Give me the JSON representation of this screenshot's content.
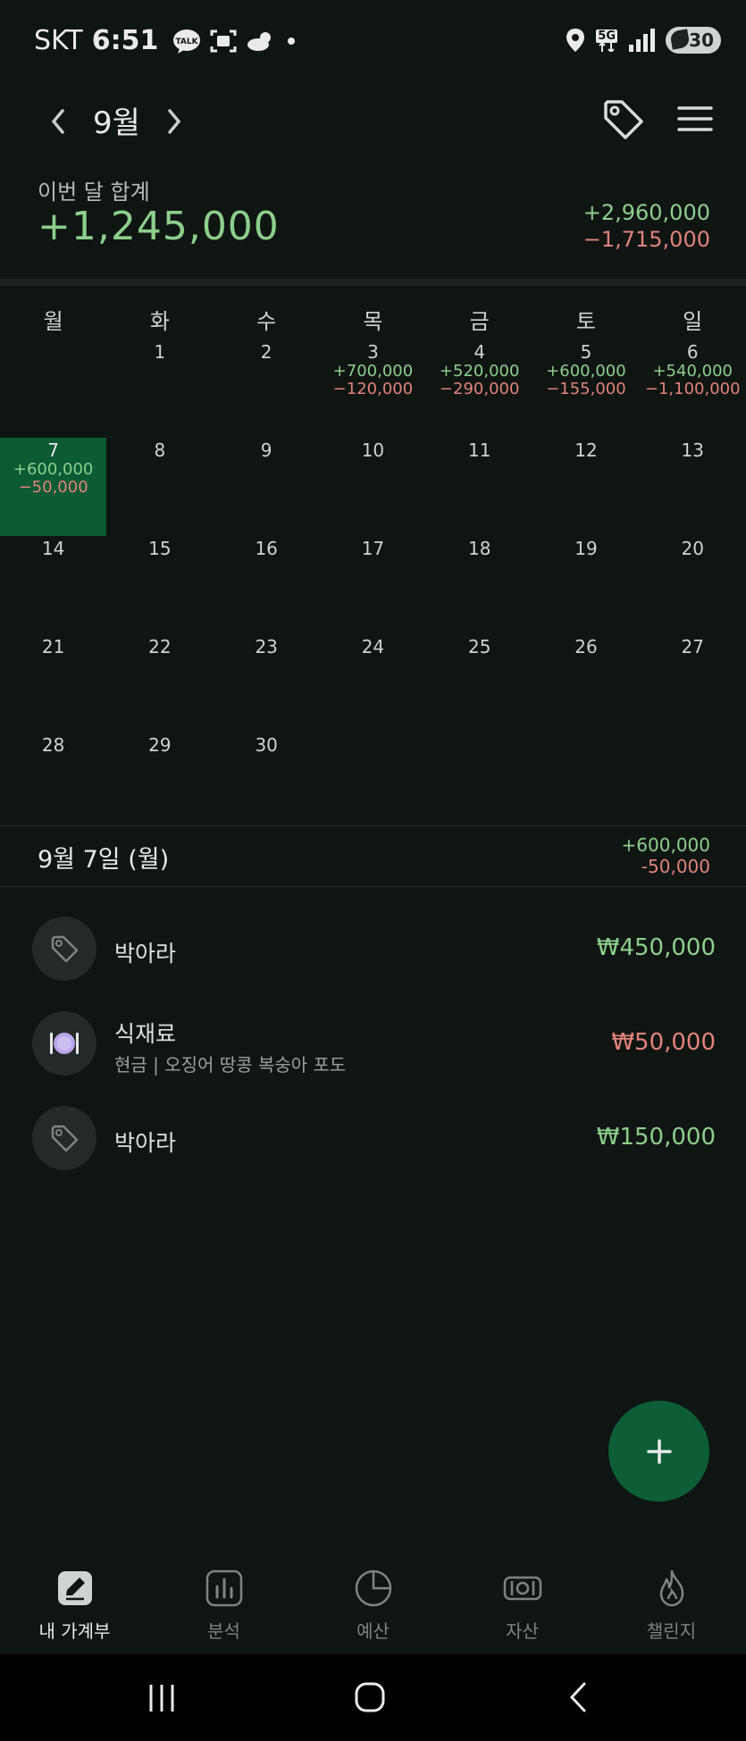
{
  "status_bar": {
    "carrier": "SKT",
    "time": "6:51",
    "network": "5G",
    "battery": "30",
    "icons": [
      "kakaotalk-icon",
      "screenshot-icon",
      "weather-icon",
      "dot-icon",
      "location-icon",
      "signal-icon",
      "battery-icon"
    ]
  },
  "header": {
    "month": "9월",
    "icons": [
      "chevron-left-icon",
      "chevron-right-icon",
      "tag-icon",
      "menu-icon"
    ]
  },
  "summary": {
    "label": "이번 달 합계",
    "total": "+1,245,000",
    "income": "+2,960,000",
    "expense": "−1,715,000"
  },
  "calendar": {
    "weekdays": [
      "월",
      "화",
      "수",
      "목",
      "금",
      "토",
      "일"
    ],
    "weeks": [
      [
        {
          "day": "",
          "income": "",
          "expense": ""
        },
        {
          "day": "1",
          "income": "",
          "expense": ""
        },
        {
          "day": "2",
          "income": "",
          "expense": ""
        },
        {
          "day": "3",
          "income": "+700,000",
          "expense": "−120,000"
        },
        {
          "day": "4",
          "income": "+520,000",
          "expense": "−290,000"
        },
        {
          "day": "5",
          "income": "+600,000",
          "expense": "−155,000"
        },
        {
          "day": "6",
          "income": "+540,000",
          "expense": "−1,100,000"
        }
      ],
      [
        {
          "day": "7",
          "income": "+600,000",
          "expense": "−50,000",
          "selected": true
        },
        {
          "day": "8",
          "income": "",
          "expense": ""
        },
        {
          "day": "9",
          "income": "",
          "expense": ""
        },
        {
          "day": "10",
          "income": "",
          "expense": ""
        },
        {
          "day": "11",
          "income": "",
          "expense": ""
        },
        {
          "day": "12",
          "income": "",
          "expense": ""
        },
        {
          "day": "13",
          "income": "",
          "expense": ""
        }
      ],
      [
        {
          "day": "14",
          "income": "",
          "expense": ""
        },
        {
          "day": "15",
          "income": "",
          "expense": ""
        },
        {
          "day": "16",
          "income": "",
          "expense": ""
        },
        {
          "day": "17",
          "income": "",
          "expense": ""
        },
        {
          "day": "18",
          "income": "",
          "expense": ""
        },
        {
          "day": "19",
          "income": "",
          "expense": ""
        },
        {
          "day": "20",
          "income": "",
          "expense": ""
        }
      ],
      [
        {
          "day": "21",
          "income": "",
          "expense": ""
        },
        {
          "day": "22",
          "income": "",
          "expense": ""
        },
        {
          "day": "23",
          "income": "",
          "expense": ""
        },
        {
          "day": "24",
          "income": "",
          "expense": ""
        },
        {
          "day": "25",
          "income": "",
          "expense": ""
        },
        {
          "day": "26",
          "income": "",
          "expense": ""
        },
        {
          "day": "27",
          "income": "",
          "expense": ""
        }
      ],
      [
        {
          "day": "28",
          "income": "",
          "expense": ""
        },
        {
          "day": "29",
          "income": "",
          "expense": ""
        },
        {
          "day": "30",
          "income": "",
          "expense": ""
        },
        {
          "day": "",
          "income": "",
          "expense": ""
        },
        {
          "day": "",
          "income": "",
          "expense": ""
        },
        {
          "day": "",
          "income": "",
          "expense": ""
        },
        {
          "day": "",
          "income": "",
          "expense": ""
        }
      ]
    ]
  },
  "day_detail": {
    "title": "9월 7일 (월)",
    "income": "+600,000",
    "expense": "-50,000"
  },
  "transactions": [
    {
      "name": "박아라",
      "sub": "",
      "amount": "₩450,000",
      "type": "income",
      "icon": "tag-icon"
    },
    {
      "name": "식재료",
      "sub": "현금 | 오징어 땅콩 복숭아 포도",
      "amount": "₩50,000",
      "type": "expense",
      "icon": "dining-icon"
    },
    {
      "name": "박아라",
      "sub": "",
      "amount": "₩150,000",
      "type": "income",
      "icon": "tag-icon"
    }
  ],
  "bottom_nav": [
    {
      "label": "내 가계부",
      "icon": "ledger-icon",
      "active": true
    },
    {
      "label": "분석",
      "icon": "analysis-icon",
      "active": false
    },
    {
      "label": "예산",
      "icon": "budget-icon",
      "active": false
    },
    {
      "label": "자산",
      "icon": "assets-icon",
      "active": false
    },
    {
      "label": "챌린지",
      "icon": "challenge-icon",
      "active": false
    }
  ],
  "colors": {
    "background": "#0f1512",
    "income": "#8ccf8c",
    "expense": "#e0837b",
    "accent": "#0d5e37"
  }
}
